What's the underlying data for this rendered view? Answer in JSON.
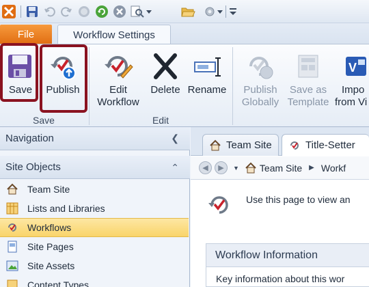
{
  "tabs": {
    "file": "File",
    "workflow_settings": "Workflow Settings"
  },
  "ribbon": {
    "save_group": {
      "label": "Save",
      "save": "Save",
      "publish": "Publish"
    },
    "edit_group": {
      "label": "Edit",
      "edit_workflow_line1": "Edit",
      "edit_workflow_line2": "Workflow",
      "delete": "Delete",
      "rename": "Rename"
    },
    "manage_group": {
      "publish_globally_line1": "Publish",
      "publish_globally_line2": "Globally",
      "save_as_template_line1": "Save as",
      "save_as_template_line2": "Template",
      "import_line1": "Impo",
      "import_line2": "from Vi"
    }
  },
  "nav": {
    "navigation_header": "Navigation",
    "site_objects_header": "Site Objects",
    "items": [
      {
        "label": "Team Site",
        "icon": "house-icon"
      },
      {
        "label": "Lists and Libraries",
        "icon": "list-table-icon"
      },
      {
        "label": "Workflows",
        "icon": "workflow-icon",
        "selected": true
      },
      {
        "label": "Site Pages",
        "icon": "site-pages-icon"
      },
      {
        "label": "Site Assets",
        "icon": "site-assets-icon"
      },
      {
        "label": "Content Types",
        "icon": "content-types-icon"
      }
    ]
  },
  "doc_tabs": {
    "team_site": "Team Site",
    "title_setter": "Title-Setter"
  },
  "breadcrumb": {
    "team_site": "Team Site",
    "current": "Workf"
  },
  "content": {
    "intro_text": "Use this page to view an",
    "workflow_information_title": "Workflow Information",
    "workflow_information_desc": "Key information about this wor"
  },
  "colors": {
    "file_tab": "#e97a1c",
    "highlight_box": "#8a1220",
    "selected_nav": "#f9d46a"
  }
}
